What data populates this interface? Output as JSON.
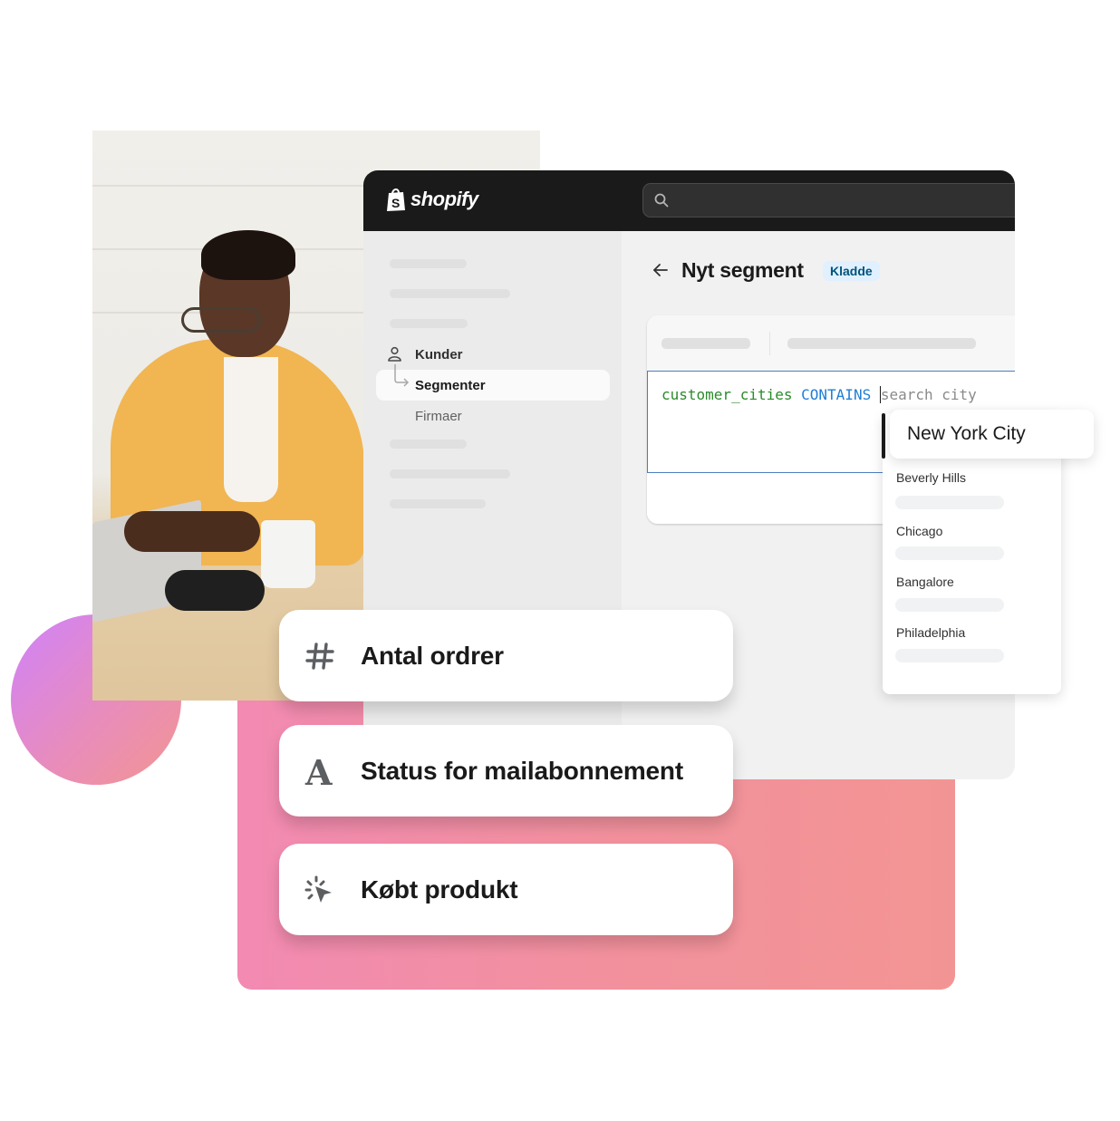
{
  "app": {
    "brand": "shopify",
    "search_placeholder": ""
  },
  "sidebar": {
    "items": [
      {
        "label": "Kunder",
        "icon": "person-icon",
        "active": false
      },
      {
        "label": "Segmenter",
        "icon": "branch-arrow-icon",
        "active": true
      },
      {
        "label": "Firmaer",
        "active": false
      }
    ]
  },
  "main": {
    "back_icon": "arrow-left-icon",
    "title": "Nyt segment",
    "badge": "Kladde",
    "query": {
      "field": "customer_cities",
      "operator": "CONTAINS",
      "placeholder": "search city"
    }
  },
  "dropdown": {
    "highlighted": "New York City",
    "options": [
      "Beverly Hills",
      "Chicago",
      "Bangalore",
      "Philadelphia"
    ]
  },
  "attributes": [
    {
      "label": "Antal ordrer",
      "icon": "hash-icon"
    },
    {
      "label": "Status for mailabonnement",
      "icon": "letter-a-icon"
    },
    {
      "label": "Købt produkt",
      "icon": "cursor-click-icon"
    }
  ],
  "colors": {
    "topbar": "#1a1a1a",
    "badge_bg": "#e0f0ff",
    "badge_text": "#00527c",
    "code_field": "#2a8a2a",
    "code_operator": "#1f7dd6",
    "editor_border": "#4a7fc1",
    "pink": "#f2919c",
    "circle_start": "#cf82fb",
    "circle_end": "#f29590"
  }
}
